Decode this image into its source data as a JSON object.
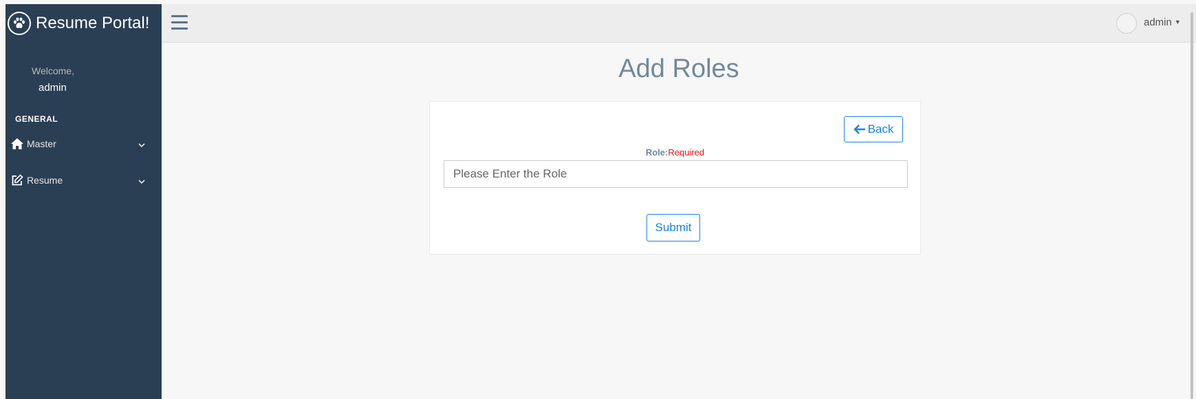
{
  "app": {
    "title": "Resume Portal!"
  },
  "sidebar": {
    "welcome_label": "Welcome,",
    "user_name": "admin",
    "section_title": "GENERAL",
    "items": [
      {
        "label": "Master",
        "icon": "home-icon"
      },
      {
        "label": "Resume",
        "icon": "edit-icon"
      }
    ]
  },
  "topbar": {
    "user_menu_label": "admin"
  },
  "page": {
    "title": "Add Roles"
  },
  "form": {
    "back_label": "Back",
    "field_label": "Role:",
    "required_label": "Required",
    "role_placeholder": "Please Enter the Role",
    "role_value": "",
    "submit_label": "Submit"
  },
  "colors": {
    "sidebar_bg": "#2a3f54",
    "accent": "#1a82e2",
    "required": "#e11111",
    "title": "#73879c"
  }
}
